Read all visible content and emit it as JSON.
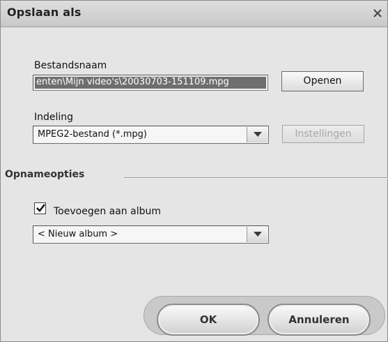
{
  "dialog": {
    "title": "Opslaan als"
  },
  "filename": {
    "label": "Bestandsnaam",
    "value": "enten\\Mijn video's\\20030703-151109.mpg",
    "open_button": "Openen"
  },
  "format": {
    "label": "Indeling",
    "selected": "MPEG2-bestand (*.mpg)",
    "settings_button": "Instellingen"
  },
  "capture_options": {
    "heading": "Opnameopties",
    "add_to_album_label": "Toevoegen aan album",
    "add_to_album_checked": true,
    "album_selected": "< Nieuw album >"
  },
  "footer": {
    "ok_label": "OK",
    "cancel_label": "Annuleren"
  },
  "icons": {
    "close": "close-icon",
    "dropdown": "chevron-down-icon",
    "check": "checkmark-icon"
  }
}
